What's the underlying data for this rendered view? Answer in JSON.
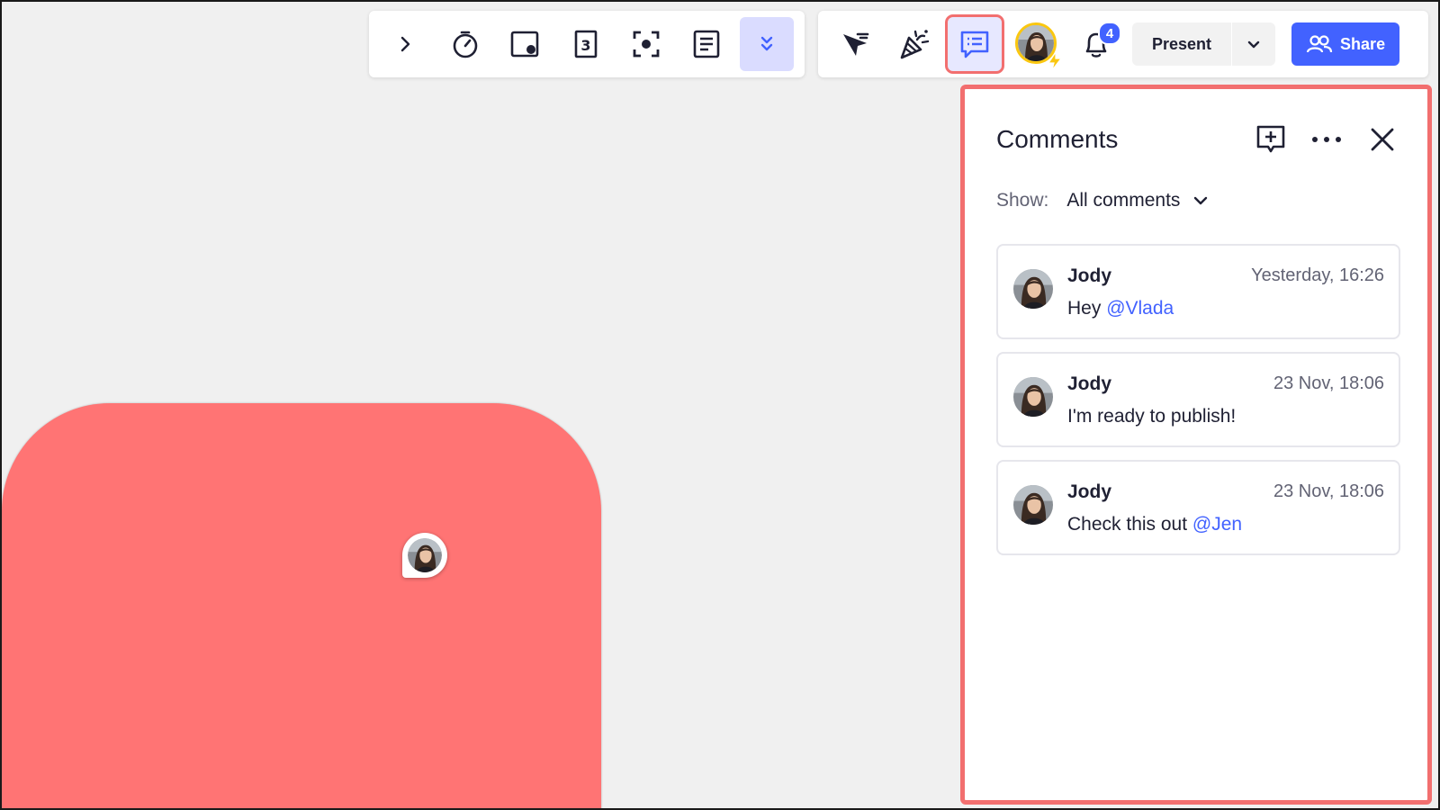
{
  "colors": {
    "canvas_bg": "#f0f0f0",
    "shape_fill": "#ff7474",
    "accent_blue": "#4262ff",
    "highlight_outline": "#f26f6f",
    "avatar_ring": "#fac710"
  },
  "toolbar_left": {
    "buttons": [
      {
        "name": "expand-chevron",
        "icon": "chevron-right-icon"
      },
      {
        "name": "timer",
        "icon": "timer-icon"
      },
      {
        "name": "card",
        "icon": "card-icon"
      },
      {
        "name": "voting",
        "icon": "voting-icon"
      },
      {
        "name": "focus",
        "icon": "focus-frame-icon"
      },
      {
        "name": "notes",
        "icon": "notes-icon"
      },
      {
        "name": "more",
        "icon": "double-chevron-down-icon",
        "selected": true
      }
    ]
  },
  "toolbar_right": {
    "buttons": [
      {
        "name": "cursor-visibility",
        "icon": "cursor-icon"
      },
      {
        "name": "reactions",
        "icon": "party-popper-icon"
      },
      {
        "name": "comments",
        "icon": "comments-icon",
        "active": true
      }
    ],
    "notifications_count": "4",
    "present_label": "Present",
    "share_label": "Share"
  },
  "comments_panel": {
    "title": "Comments",
    "filter_label": "Show:",
    "filter_value": "All comments",
    "comments": [
      {
        "author": "Jody",
        "time": "Yesterday, 16:26",
        "text_before": "Hey ",
        "mention": "@Vlada"
      },
      {
        "author": "Jody",
        "time": "23 Nov, 18:06",
        "text_before": "I'm ready to publish!",
        "mention": ""
      },
      {
        "author": "Jody",
        "time": "23 Nov, 18:06",
        "text_before": "Check this out ",
        "mention": "@Jen"
      }
    ]
  }
}
